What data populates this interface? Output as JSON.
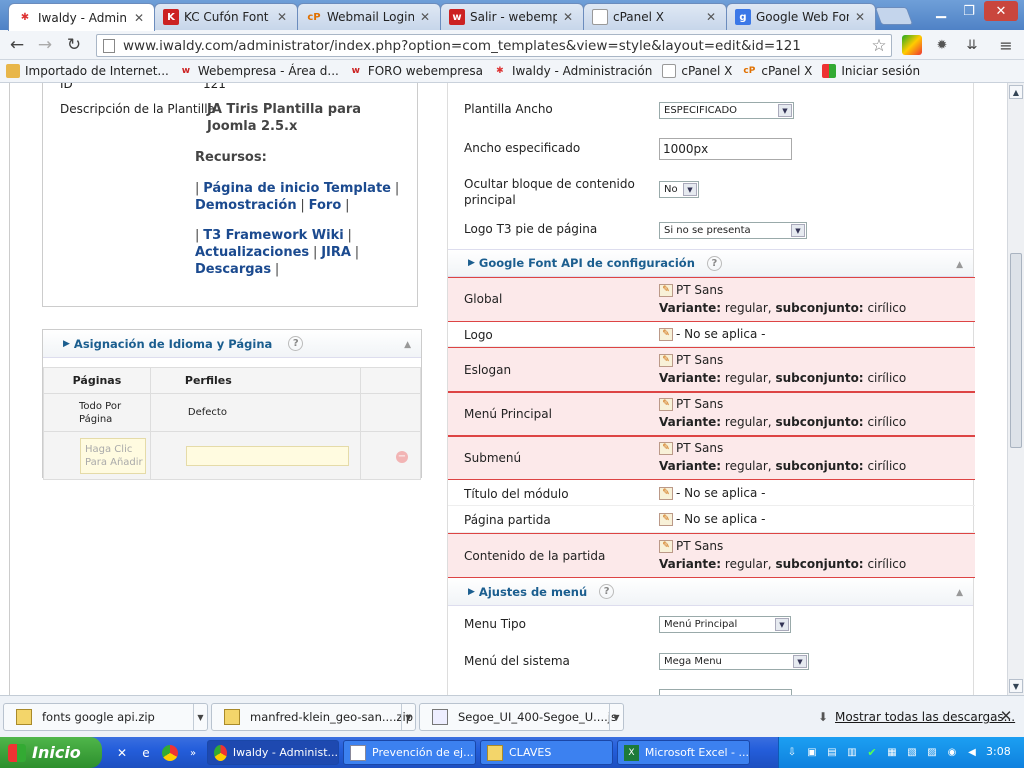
{
  "browser": {
    "tabs": [
      {
        "title": "Iwaldy - Administr",
        "icon": "joomla-icon",
        "active": true
      },
      {
        "title": "KC Cufón Font Rep",
        "icon": "kc-icon",
        "active": false
      },
      {
        "title": "Webmail Login",
        "icon": "cpanel-icon",
        "active": false
      },
      {
        "title": "Salir - webempresa",
        "icon": "webempresa-icon",
        "active": false
      },
      {
        "title": "cPanel X",
        "icon": "page-icon",
        "active": false
      },
      {
        "title": "Google Web Fonts",
        "icon": "google-icon",
        "active": false
      }
    ],
    "url": "www.iwaldy.com/administrator/index.php?option=com_templates&view=style&layout=edit&id=121",
    "bookmarks": [
      {
        "label": "Importado de Internet...",
        "icon": "folder-icon"
      },
      {
        "label": "Webempresa - Área d...",
        "icon": "webempresa-icon"
      },
      {
        "label": "FORO webempresa",
        "icon": "webempresa-icon"
      },
      {
        "label": "Iwaldy - Administración",
        "icon": "joomla-icon"
      },
      {
        "label": "cPanel X",
        "icon": "page-icon"
      },
      {
        "label": "cPanel X",
        "icon": "cpanel-icon"
      },
      {
        "label": "Iniciar sesión",
        "icon": "windows-flag-icon"
      }
    ]
  },
  "left": {
    "id_label": "ID",
    "id_value": "121",
    "desc_label": "Descripción de la Plantilla",
    "desc_value_line1": "JA Tiris Plantilla para",
    "desc_value_line2": "Joomla 2.5.x",
    "recursos": "Recursos:",
    "links": {
      "inicio": "Página de inicio Template",
      "demo": "Demostración",
      "foro": "Foro",
      "wiki": "T3 Framework Wiki",
      "updates": "Actualizaciones",
      "jira": "JIRA",
      "descargas": "Descargas"
    },
    "separator": "|",
    "assign": {
      "title": "Asignación de Idioma y Página",
      "help": "?",
      "col_paginas": "Páginas",
      "col_perfiles": "Perfiles",
      "row_pagina_l1": "Todo Por",
      "row_pagina_l2": "Página",
      "row_perfil": "Defecto",
      "add_l1": "Haga Clic",
      "add_l2": "Para Añadir"
    }
  },
  "right": {
    "plantilla_ancho_label": "Plantilla Ancho",
    "plantilla_ancho_value": "ESPECIFICADO",
    "ancho_label": "Ancho especificado",
    "ancho_value": "1000px",
    "ocultar_label_l1": "Ocultar bloque de contenido",
    "ocultar_label_l2": "principal",
    "ocultar_value": "No",
    "logo_label": "Logo T3 pie de página",
    "logo_value": "Si no se presenta",
    "gfont_title": "Google Font API de configuración",
    "help": "?",
    "variante_label": "Variante:",
    "variante_value": "regular,",
    "subconjunto_label": "subconjunto:",
    "subconjunto_value": "cirílico",
    "font_name": "PT Sans",
    "no_aplica": "- No se aplica -",
    "rows": {
      "global": "Global",
      "logo": "Logo",
      "eslogan": "Eslogan",
      "menu_principal": "Menú Principal",
      "submenu": "Submenú",
      "titulo_modulo": "Título del módulo",
      "pagina_partida": "Página partida",
      "contenido_partida": "Contenido de la partida"
    },
    "menu_title": "Ajustes de menú",
    "menu_tipo_label": "Menu Tipo",
    "menu_tipo_value": "Menú Principal",
    "menu_sistema_label": "Menú del sistema",
    "menu_sistema_value": "Mega Menu"
  },
  "downloads": {
    "items": [
      "fonts google api.zip",
      "manfred-klein_geo-san....zip",
      "Segoe_UI_400-Segoe_U....js"
    ],
    "show_all": "Mostrar todas las descargas..."
  },
  "taskbar": {
    "start": "Inicio",
    "buttons": [
      "Iwaldy - Administ...",
      "Prevención de ej...",
      "CLAVES",
      "Microsoft Excel - ..."
    ],
    "clock": "3:08"
  }
}
